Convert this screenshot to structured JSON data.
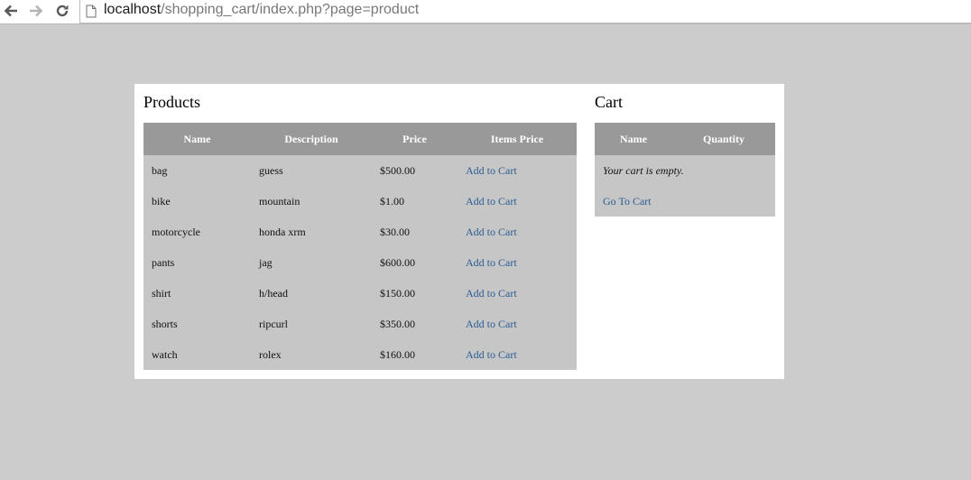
{
  "browser": {
    "url_host": "localhost",
    "url_path": "/shopping_cart/index.php?page=product"
  },
  "products": {
    "title": "Products",
    "columns": [
      "Name",
      "Description",
      "Price",
      "Items Price"
    ],
    "rows": [
      {
        "name": "bag",
        "description": "guess",
        "price": "$500.00",
        "action": "Add to Cart"
      },
      {
        "name": "bike",
        "description": "mountain",
        "price": "$1.00",
        "action": "Add to Cart"
      },
      {
        "name": "motorcycle",
        "description": "honda xrm",
        "price": "$30.00",
        "action": "Add to Cart"
      },
      {
        "name": "pants",
        "description": "jag",
        "price": "$600.00",
        "action": "Add to Cart"
      },
      {
        "name": "shirt",
        "description": "h/head",
        "price": "$150.00",
        "action": "Add to Cart"
      },
      {
        "name": "shorts",
        "description": "ripcurl",
        "price": "$350.00",
        "action": "Add to Cart"
      },
      {
        "name": "watch",
        "description": "rolex",
        "price": "$160.00",
        "action": "Add to Cart"
      }
    ]
  },
  "cart": {
    "title": "Cart",
    "columns": [
      "Name",
      "Quantity"
    ],
    "empty_message": "Your cart is empty.",
    "go_to_cart": "Go To Cart"
  },
  "colors": {
    "page_bg": "#cccccc",
    "header_bg": "#999999",
    "table_bg": "#c6c6c6",
    "link": "#2a5d93"
  }
}
